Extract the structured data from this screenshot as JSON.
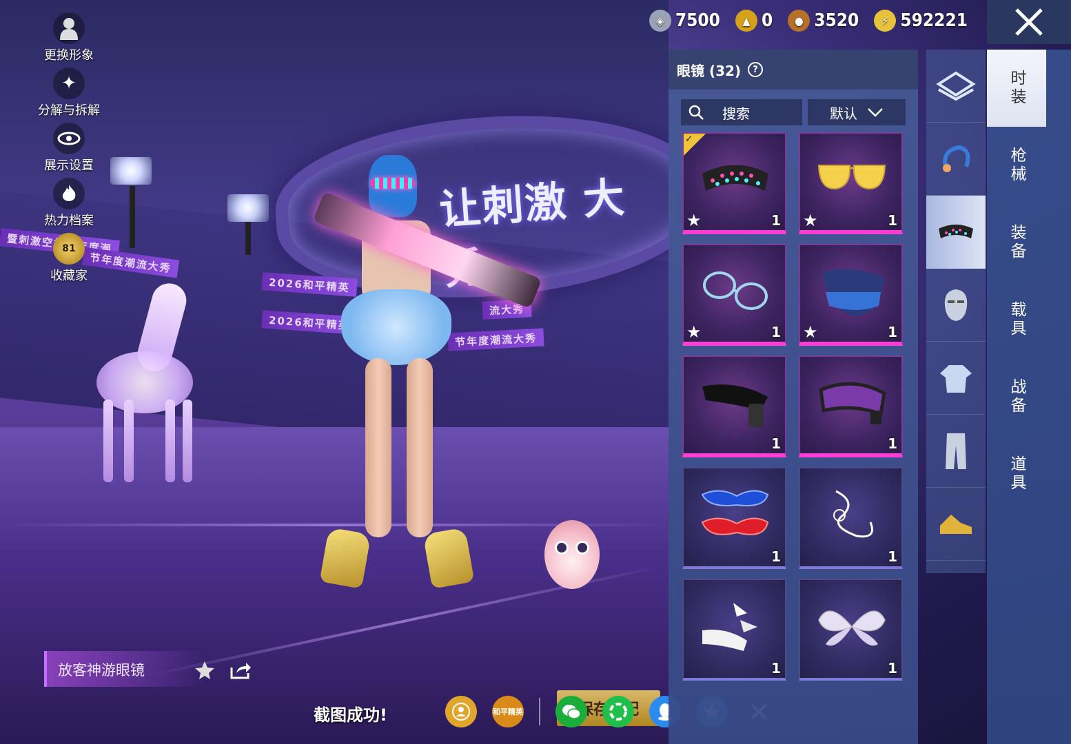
{
  "left_menu": [
    {
      "label": "更换形象",
      "icon": "person-icon"
    },
    {
      "label": "分解与拆解",
      "icon": "puzzle-icon"
    },
    {
      "label": "展示设置",
      "icon": "eye-icon"
    },
    {
      "label": "热力档案",
      "icon": "flame-icon"
    },
    {
      "label": "收藏家",
      "icon": "collector-badge-icon",
      "badge": "81"
    }
  ],
  "scene": {
    "banner": "让刺激 大秀",
    "ribbons": [
      "节年度潮流大秀",
      "2026和平精英",
      "暨刺激空投节年度潮",
      "2026和平精英",
      "节年度潮流大秀",
      "流大秀"
    ]
  },
  "item_name": "放客神游眼镜",
  "screenshot_toast": "截图成功!",
  "save_outfit": "保存搭配",
  "share_game_logo": "和平精英",
  "currency": [
    {
      "value": "7500",
      "icon": "coupon-icon",
      "color": "#9aa3b5"
    },
    {
      "value": "0",
      "icon": "medal-icon",
      "color": "#d6a21a"
    },
    {
      "value": "3520",
      "icon": "coin-icon",
      "color": "#b5702a"
    },
    {
      "value": "592221",
      "icon": "lightning-icon",
      "color": "#e8c23a"
    }
  ],
  "panel": {
    "title": "眼镜 (32)",
    "search": "搜索",
    "sort": "默认",
    "items": [
      {
        "name": "led-visor",
        "qty": "1",
        "starred": true,
        "equipped": true,
        "rarity": "pink"
      },
      {
        "name": "yellow-sunglasses",
        "qty": "1",
        "starred": true,
        "equipped": false,
        "rarity": "pink"
      },
      {
        "name": "round-wire-glasses",
        "qty": "1",
        "starred": true,
        "equipped": false,
        "rarity": "pink"
      },
      {
        "name": "digital-shield-visor",
        "qty": "1",
        "starred": true,
        "equipped": false,
        "rarity": "pink"
      },
      {
        "name": "tactical-shades",
        "qty": "1",
        "starred": false,
        "equipped": false,
        "rarity": "pink"
      },
      {
        "name": "purple-goggles",
        "qty": "1",
        "starred": false,
        "equipped": false,
        "rarity": "pink"
      },
      {
        "name": "feather-masks",
        "qty": "1",
        "starred": false,
        "equipped": false,
        "rarity": "purple"
      },
      {
        "name": "ribbon-glasses",
        "qty": "1",
        "starred": false,
        "equipped": false,
        "rarity": "purple"
      },
      {
        "name": "white-bow-band",
        "qty": "1",
        "starred": false,
        "equipped": false,
        "rarity": "purple"
      },
      {
        "name": "butterfly-mask",
        "qty": "1",
        "starred": false,
        "equipped": false,
        "rarity": "purple"
      }
    ]
  },
  "rail": [
    {
      "icon": "wardrobe-icon"
    },
    {
      "icon": "headwear-icon"
    },
    {
      "icon": "glasses-icon"
    },
    {
      "icon": "mask-icon"
    },
    {
      "icon": "top-icon"
    },
    {
      "icon": "pants-icon"
    },
    {
      "icon": "shoes-icon"
    }
  ],
  "tabs": [
    "时装",
    "枪械",
    "装备",
    "载具",
    "战备",
    "道具"
  ]
}
